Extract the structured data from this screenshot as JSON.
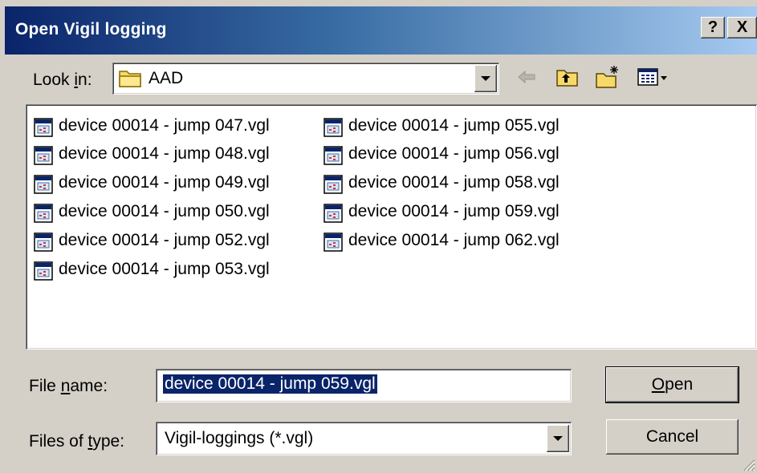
{
  "window": {
    "title": "Open Vigil logging",
    "help_label": "?",
    "close_label": "X"
  },
  "look_in": {
    "label_pre": "Look ",
    "label_accel": "i",
    "label_post": "n:",
    "value": "AAD",
    "icon": "folder-icon"
  },
  "toolbar": {
    "icons": [
      "back-arrow-icon",
      "up-folder-icon",
      "new-folder-icon",
      "view-menu-icon"
    ]
  },
  "files": [
    "device 00014 - jump 047.vgl",
    "device 00014 - jump 048.vgl",
    "device 00014 - jump 049.vgl",
    "device 00014 - jump 050.vgl",
    "device 00014 - jump 052.vgl",
    "device 00014 - jump 053.vgl",
    "device 00014 - jump 055.vgl",
    "device 00014 - jump 056.vgl",
    "device 00014 - jump 058.vgl",
    "device 00014 - jump 059.vgl",
    "device 00014 - jump 062.vgl"
  ],
  "file_name": {
    "label_pre": "File ",
    "label_accel": "n",
    "label_post": "ame:",
    "value": "device 00014 - jump 059.vgl"
  },
  "file_type": {
    "label_pre": "Files of ",
    "label_accel": "t",
    "label_post": "ype:",
    "value": "Vigil-loggings (*.vgl)"
  },
  "buttons": {
    "open_accel": "O",
    "open_rest": "pen",
    "cancel": "Cancel"
  },
  "colors": {
    "face": "#d4d0c8",
    "title_start": "#0a246a",
    "title_end": "#a6caf0",
    "selection": "#0a246a"
  }
}
